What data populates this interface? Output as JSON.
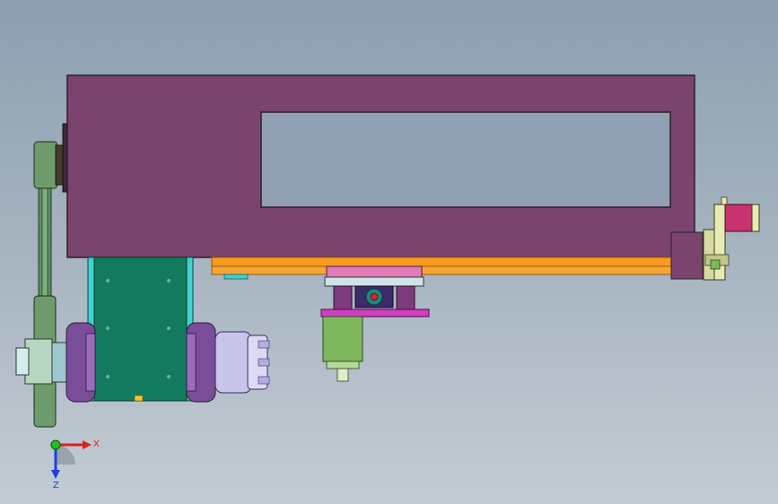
{
  "app": {
    "view": "cad-3d-viewport",
    "part_colors": {
      "housing": "#7b446f",
      "housing_edge": "#2c1f2b",
      "rail": "#f79a1f",
      "rail_edge": "#a4560a",
      "spindle_block": "#137a5e",
      "spindle_block_edge": "#0d3b2e",
      "bearing_ring": "#7a4d99",
      "chuck": "#c8c4ea",
      "pulley": "#6d9b6b",
      "belt": "#5d8e62",
      "stepper_motor": "#c7336e",
      "motor_flange": "#e8eab2",
      "slide_base": "#d23fc0",
      "slide_blocks": "#7e3b7d",
      "gear_motor": "#7fb85c",
      "teal_plates": "#3fd2cf"
    }
  },
  "triad": {
    "x_label": "X",
    "y_label": "Z",
    "x_color": "#e02020",
    "y_color": "#2040e0",
    "origin_color": "#20c020"
  }
}
